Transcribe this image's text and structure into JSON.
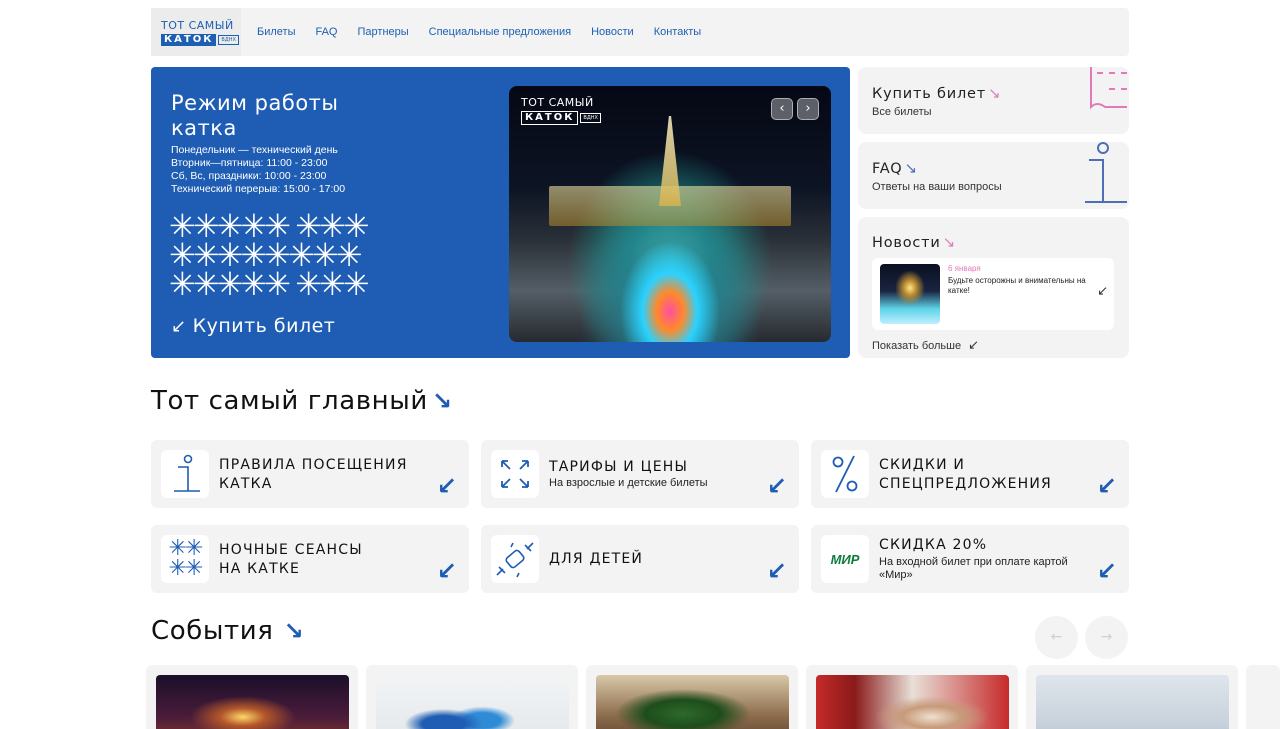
{
  "header": {
    "logo_top": "ТОТ САМЫЙ",
    "logo_word": "КАТОК",
    "logo_tag": "ВДНХ",
    "nav": [
      "Билеты",
      "FAQ",
      "Партнеры",
      "Специальные предложения",
      "Новости",
      "Контакты"
    ]
  },
  "hero": {
    "title": "Режим работы катка",
    "schedule": [
      "Понедельник — технический день",
      "Вторник—пятница: 11:00 - 23:00",
      "Сб, Вс, праздники: 10:00 - 23:00",
      "Технический перерыв: 15:00 - 17:00"
    ],
    "snowflakes": [
      "✳✳✳✳✳ ✳✳✳",
      "✳✳✳✳✳✳✳✳",
      "✳✳✳✳✳ ✳✳✳"
    ],
    "buy_label": "Купить билет",
    "buy_arrow": "↙",
    "photo_logo_top": "ТОТ САМЫЙ",
    "photo_logo_word": "КАТОК",
    "photo_logo_tag": "ВДНХ",
    "prev": "‹",
    "next": "›"
  },
  "side": {
    "buy": {
      "title": "Купить билет",
      "arrow": "↘",
      "sub": "Все билеты"
    },
    "faq": {
      "title": "FAQ",
      "arrow": "↘",
      "sub": "Ответы на ваши вопросы"
    },
    "news": {
      "title": "Новости",
      "arrow": "↘",
      "item_date": "6 января",
      "item_text": "Будьте осторожны и внимательны на катке!",
      "item_arrow": "↙",
      "show_more": "Показать больше",
      "show_more_arrow": "↙"
    }
  },
  "main_section": {
    "heading": "Тот самый главный",
    "arrow": "↘",
    "cards": [
      {
        "title_1": "ПРАВИЛА ПОСЕЩЕНИЯ",
        "title_2": "КАТКА",
        "sub_1": "",
        "sub_2": "",
        "icon": "info-icon",
        "arrow": "↙"
      },
      {
        "title_1": "ТАРИФЫ И ЦЕНЫ",
        "title_2": "",
        "sub_1": "На взрослые и детские билеты",
        "sub_2": "",
        "icon": "expand-icon",
        "arrow": "↙"
      },
      {
        "title_1": "СКИДКИ И",
        "title_2": "СПЕЦПРЕДЛОЖЕНИЯ",
        "sub_1": "",
        "sub_2": "",
        "icon": "percent-icon",
        "arrow": "↙"
      },
      {
        "title_1": "НОЧНЫЕ СЕАНСЫ",
        "title_2": "НА КАТКЕ",
        "sub_1": "",
        "sub_2": "",
        "icon": "snowflake-icon",
        "arrow": "↙"
      },
      {
        "title_1": "ДЛЯ ДЕТЕЙ",
        "title_2": "",
        "sub_1": "",
        "sub_2": "",
        "icon": "candy-icon",
        "arrow": "↙"
      },
      {
        "title_1": "СКИДКА 20%",
        "title_2": "",
        "sub_1": "На входной билет при оплате картой",
        "sub_2": "«Мир»",
        "icon": "mir-logo-icon",
        "arrow": "↙"
      }
    ],
    "mir_logo": "МИР"
  },
  "events": {
    "heading": "События",
    "arrow": "↘",
    "prev": "←",
    "next": "→"
  },
  "colors": {
    "brand_blue": "#1e5db3",
    "pink_accent": "#e07bb8",
    "card_bg": "#f3f3f3"
  }
}
